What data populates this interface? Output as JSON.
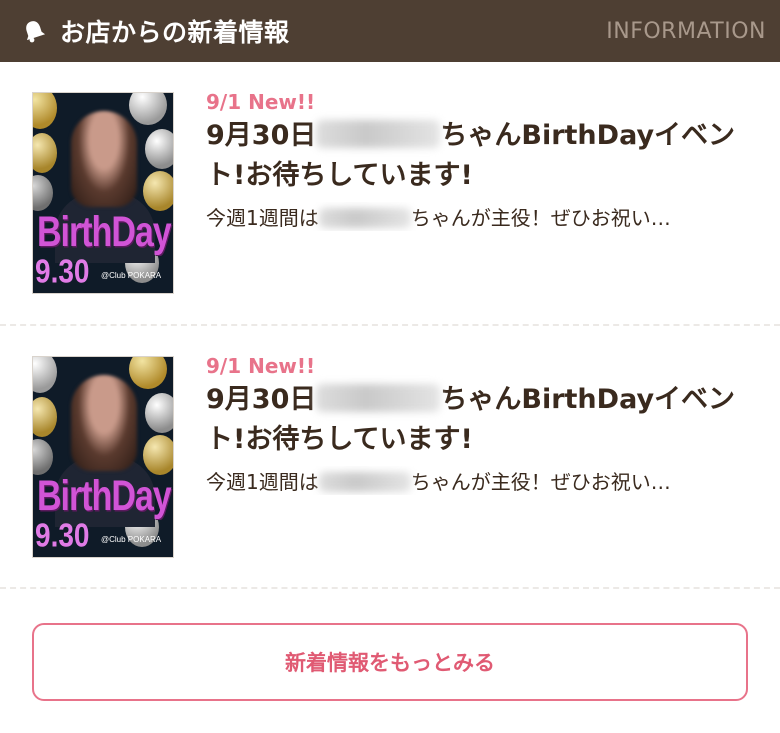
{
  "header": {
    "icon": "bell-icon",
    "title": "お店からの新着情報",
    "title_en": "INFORMATION"
  },
  "news": [
    {
      "date": "9/1 New!!",
      "title_prefix": "9月30日",
      "title_suffix": "ちゃんBirthDayイベント!お待ちしています!",
      "excerpt_prefix": "今週1週間は",
      "excerpt_suffix": "ちゃんが主役！ぜひお祝い…",
      "thumb_text": "BirthDay",
      "thumb_date": "9.30",
      "thumb_club": "@Club POKARA"
    },
    {
      "date": "9/1 New!!",
      "title_prefix": "9月30日",
      "title_suffix": "ちゃんBirthDayイベント!お待ちしています!",
      "excerpt_prefix": "今週1週間は",
      "excerpt_suffix": "ちゃんが主役！ぜひお祝い…",
      "thumb_text": "BirthDay",
      "thumb_date": "9.30",
      "thumb_club": "@Club POKARA"
    }
  ],
  "more_button": {
    "label": "新着情報をもっとみる"
  },
  "colors": {
    "header_bg": "#4e3f33",
    "accent": "#e8738a",
    "text": "#3a2a1e"
  }
}
